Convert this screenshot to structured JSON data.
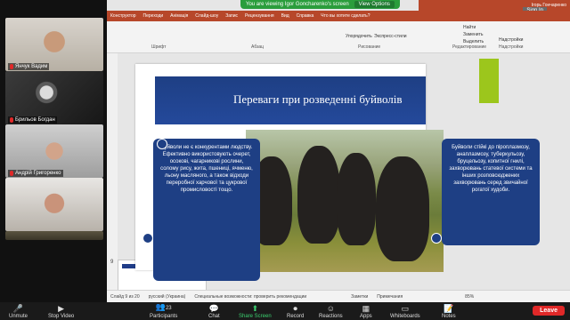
{
  "participants": [
    {
      "name": "Янчук Вадим",
      "muted": true
    },
    {
      "name": "Брильов Богдан",
      "muted": true
    },
    {
      "name": "Андрій Григоренко",
      "muted": true
    },
    {
      "name": "",
      "muted": false
    }
  ],
  "share_banner": {
    "text": "You are viewing Igor Goncharenko's screen",
    "options": "View Options"
  },
  "powerpoint": {
    "tabs": [
      "Конструктор",
      "Переходи",
      "Анімація",
      "Слайд-шоу",
      "Запис",
      "Рецензування",
      "Вид",
      "Справка",
      "Что вы хотите сделать?"
    ],
    "user": "Ігорь Гончаренко",
    "sign_in": "Sign In",
    "groups": [
      "Шрифт",
      "Абзац",
      "Рисование",
      "Редактирование",
      "Надстройки"
    ],
    "ribbon_buttons": [
      "Упорядочить",
      "Экспресс-стили",
      "Найти",
      "Заменить",
      "Выделить",
      "Надстройки"
    ],
    "slide_number": "9",
    "slide_title": "Переваги при розведенні буйволів",
    "left_text": "Буйволи не є конкурентами людству. Ефективно використовують очерет, осоковi, чагарникові рослини, солому рису, жита, пшениці, ячменю, льону масляного, а також відходи переробної харчової та цукрової промисловості тощо.",
    "right_text": "Буйволи стійкі до піроплазмозу, анаплазмозу, туберкульозу, бруцельозу, копитної гнилі, захворювань статевої системи та інших розповсюджених захворювань серед звичайної рогатої худоби.",
    "status": [
      "Слайд 9 из 20",
      "русский (Украина)",
      "Специальные возможности: проверить рекомендации",
      "Заметки",
      "Примечания",
      "85%"
    ]
  },
  "toolbar": {
    "items": [
      {
        "label": "Unmute",
        "icon": "microphone-muted-icon"
      },
      {
        "label": "Stop Video",
        "icon": "video-icon"
      },
      {
        "label": "Participants",
        "icon": "participants-icon",
        "count": "23"
      },
      {
        "label": "Chat",
        "icon": "chat-icon"
      },
      {
        "label": "Share Screen",
        "icon": "share-screen-icon"
      },
      {
        "label": "Record",
        "icon": "record-icon"
      },
      {
        "label": "Reactions",
        "icon": "reactions-icon"
      },
      {
        "label": "Apps",
        "icon": "apps-icon"
      },
      {
        "label": "Whiteboards",
        "icon": "whiteboard-icon"
      },
      {
        "label": "Notes",
        "icon": "notes-icon"
      }
    ],
    "leave": "Leave"
  },
  "colors": {
    "zoom_green": "#2a9d3c",
    "leave_red": "#e02828",
    "slide_blue": "#1e3f84",
    "accent_green": "#9cc61c",
    "ribbon": "#b7472a"
  }
}
